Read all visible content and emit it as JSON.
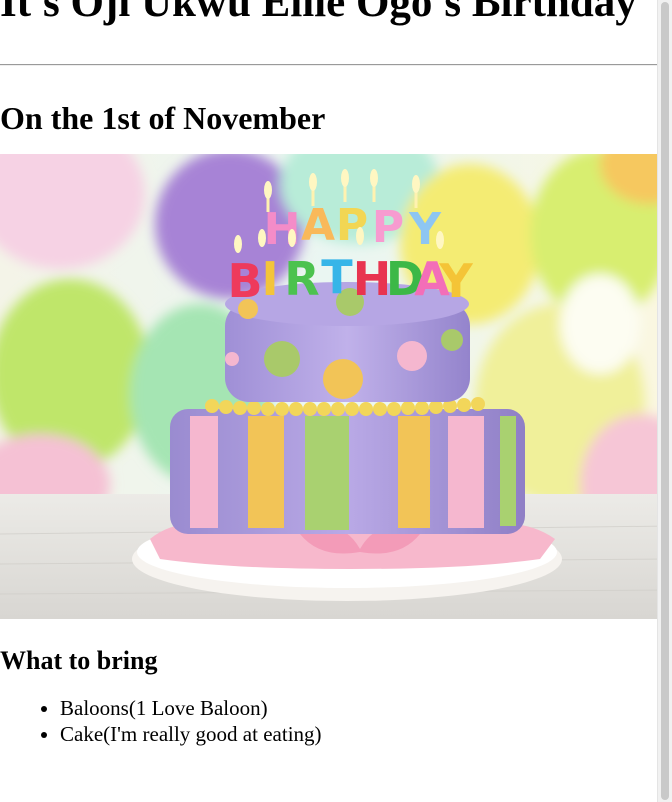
{
  "header": {
    "title": "It's Oji Ukwu Elile Ogo's Birthday",
    "date": "On the 1st of November"
  },
  "hero_image": {
    "alt": "Birthday cake",
    "caption_top": "HAPPY",
    "caption_bottom": "BIRTHDAY"
  },
  "bring": {
    "heading": "What to bring",
    "items": [
      "Baloons(1 Love Baloon)",
      "Cake(I'm really good at eating)"
    ]
  },
  "colors": {
    "text": "#000000",
    "background": "#ffffff",
    "rule": "#9a9a9a"
  }
}
